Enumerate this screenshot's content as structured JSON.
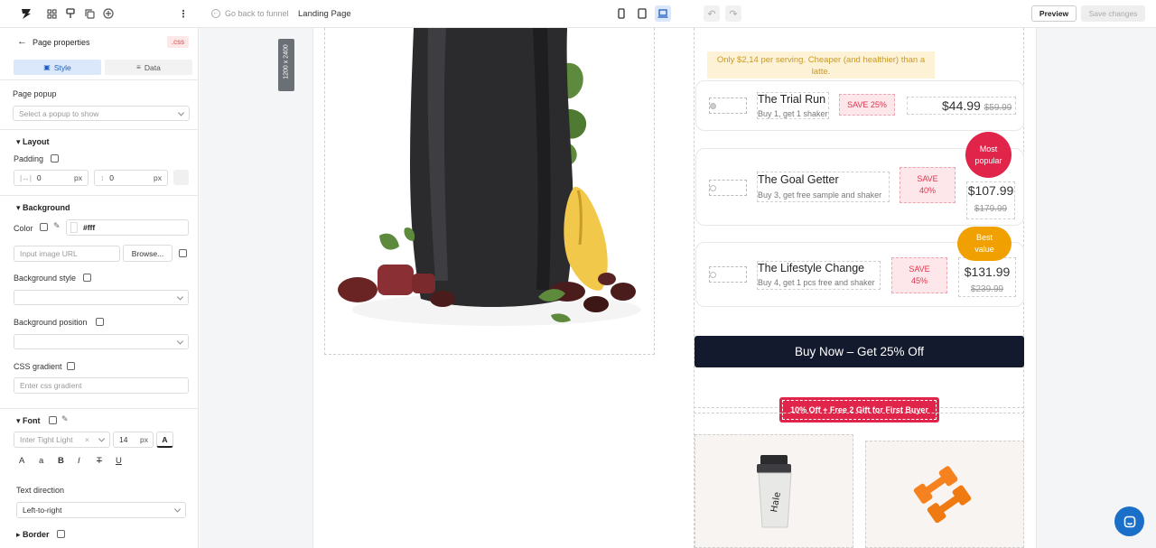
{
  "topbar": {
    "back_label": "Go back to funnel",
    "page_name": "Landing Page",
    "preview_label": "Preview",
    "save_label": "Save changes"
  },
  "sidebar": {
    "title": "Page properties",
    "css_badge": ".css",
    "tabs": [
      "Style",
      "Data"
    ],
    "page_popup_label": "Page popup",
    "page_popup_placeholder": "Select a popup to show",
    "layout_label": "Layout",
    "padding_label": "Padding",
    "padding_x": "0",
    "padding_y": "0",
    "unit_px": "px",
    "background_label": "Background",
    "color_label": "Color",
    "color_value": "#fff",
    "image_url_placeholder": "Input image URL",
    "browse_label": "Browse...",
    "bg_style_label": "Background style",
    "bg_position_label": "Background position",
    "css_gradient_label": "CSS gradient",
    "css_gradient_placeholder": "Enter css gradient",
    "font_label": "Font",
    "font_family": "Inter Tight Light",
    "font_size": "14",
    "text_direction_label": "Text direction",
    "text_direction_value": "Left-to-right",
    "border_label": "Border",
    "format_buttons": [
      "A",
      "a",
      "B",
      "I",
      "T",
      "U"
    ]
  },
  "canvas": {
    "size_tag": "1200 x 2400",
    "promo_note": "Only $2,14 per serving. Cheaper (and healthier) than a latte.",
    "plans": [
      {
        "title": "The Trial Run",
        "subtitle": "Buy 1, get 1 shaker",
        "save": "SAVE 25%",
        "price": "$44.99",
        "old_price": "$59.99"
      },
      {
        "title": "The Goal Getter",
        "subtitle": "Buy 3, get free sample and shaker",
        "save": "SAVE 40%",
        "price": "$107.99",
        "old_price": "$179.99",
        "badge": "Most popular"
      },
      {
        "title": "The Lifestyle Change",
        "subtitle": "Buy 4, get 1 pcs free and shaker",
        "save": "SAVE 45%",
        "price": "$131.99",
        "old_price": "$239.99",
        "badge": "Best value"
      }
    ],
    "buy_button": "Buy Now – Get 25% Off",
    "offer_banner": "10% Off + Free 2 Gift for First Buyer"
  },
  "colors": {
    "accent_red": "#e0244a",
    "badge_orange": "#f0a000",
    "buy_button_bg": "#141a2e",
    "promo_bg": "#fdf1d6",
    "chat_button": "#1a6fc9",
    "device_active": "#dbe7fb"
  },
  "icons": [
    "logo-icon",
    "grid-icon",
    "brush-icon",
    "copy-icon",
    "plus-circle-icon",
    "more-icon",
    "phone-icon",
    "tablet-icon",
    "laptop-icon",
    "undo-icon",
    "redo-icon",
    "chat-icon"
  ]
}
